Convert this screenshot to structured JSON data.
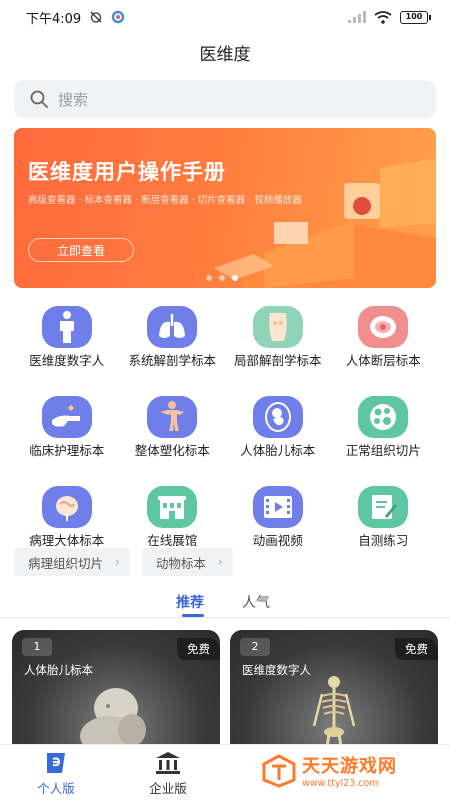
{
  "status_bar": {
    "time": "下午4:09",
    "battery": "100"
  },
  "app": {
    "title": "医维度"
  },
  "search": {
    "placeholder": "搜索"
  },
  "banner": {
    "title": "医维度用户操作手册",
    "subtitle": "高级查看器 · 标本查看器 · 断层查看器 · 切片查看器 · 视频播放器",
    "button": "立即查看",
    "slides": 3,
    "active_slide": 3
  },
  "features": [
    {
      "label": "医维度数字人",
      "icon": "human-body-icon",
      "color": "#6f7ee8"
    },
    {
      "label": "系统解剖学标本",
      "icon": "lungs-icon",
      "color": "#6f7ee8"
    },
    {
      "label": "局部解剖学标本",
      "icon": "torso-icon",
      "color": "#8fd4b8"
    },
    {
      "label": "人体断层标本",
      "icon": "cross-section-icon",
      "color": "#f08d8d"
    },
    {
      "label": "临床护理标本",
      "icon": "hand-care-icon",
      "color": "#6f7ee8"
    },
    {
      "label": "整体塑化标本",
      "icon": "plastinate-body-icon",
      "color": "#6f7ee8"
    },
    {
      "label": "人体胎儿标本",
      "icon": "fetus-icon",
      "color": "#6f7ee8"
    },
    {
      "label": "正常组织切片",
      "icon": "tissue-slice-icon",
      "color": "#5fc6a2"
    },
    {
      "label": "病理大体标本",
      "icon": "pathology-icon",
      "color": "#6f7ee8"
    },
    {
      "label": "在线展馆",
      "icon": "museum-icon",
      "color": "#5fc6a2"
    },
    {
      "label": "动画视频",
      "icon": "video-icon",
      "color": "#6f7ee8"
    },
    {
      "label": "自测练习",
      "icon": "quiz-icon",
      "color": "#5fc6a2"
    }
  ],
  "chips": [
    {
      "label": "病理组织切片"
    },
    {
      "label": "动物标本"
    }
  ],
  "tabs": [
    {
      "label": "推荐",
      "active": true
    },
    {
      "label": "人气",
      "active": false
    }
  ],
  "cards": [
    {
      "rank": "1",
      "badge": "免费",
      "title": "人体胎儿标本"
    },
    {
      "rank": "2",
      "badge": "免费",
      "title": "医维度数字人"
    }
  ],
  "bottom_nav": [
    {
      "label": "个人版",
      "active": true
    },
    {
      "label": "企业版",
      "active": false
    }
  ],
  "watermark": {
    "title": "天天游戏网",
    "url": "www.ttyl23.com"
  },
  "colors": {
    "accent": "#3a69d8",
    "banner": "#ff7a3e"
  }
}
